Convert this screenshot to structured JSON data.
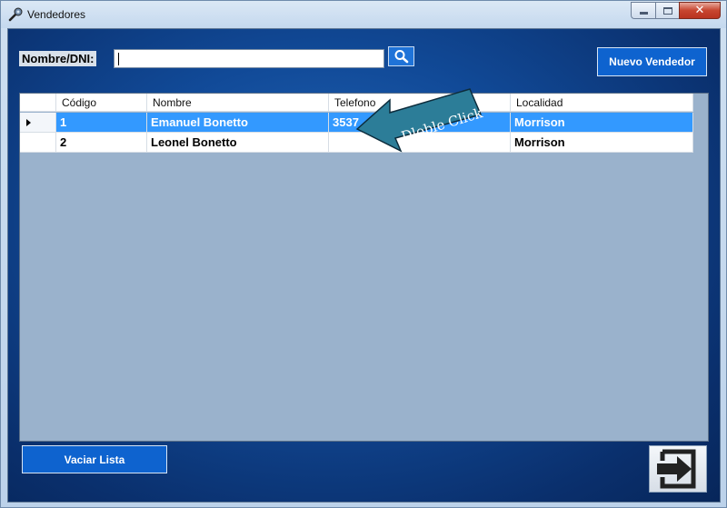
{
  "window": {
    "title": "Vendedores",
    "close_glyph": "✕"
  },
  "search": {
    "label": "Nombre/DNI:",
    "value": "",
    "placeholder": ""
  },
  "buttons": {
    "new_seller": "Nuevo Vendedor",
    "clear_list": "Vaciar Lista"
  },
  "grid": {
    "columns": [
      "Código",
      "Nombre",
      "Telefono",
      "Localidad"
    ],
    "rows": [
      {
        "codigo": "1",
        "nombre": "Emanuel Bonetto",
        "telefono": "3537",
        "localidad": "Morrison",
        "selected": true
      },
      {
        "codigo": "2",
        "nombre": "Leonel Bonetto",
        "telefono": "",
        "localidad": "Morrison",
        "selected": false
      }
    ]
  },
  "annotation": {
    "text": "Dloble Click"
  },
  "icons": {
    "title": "tools-icon",
    "search": "search-icon",
    "exit": "exit-door-arrow-icon"
  },
  "colors": {
    "accent_button": "#0e63cf",
    "selection": "#3399ff",
    "background_dark": "#0a2f6c"
  }
}
